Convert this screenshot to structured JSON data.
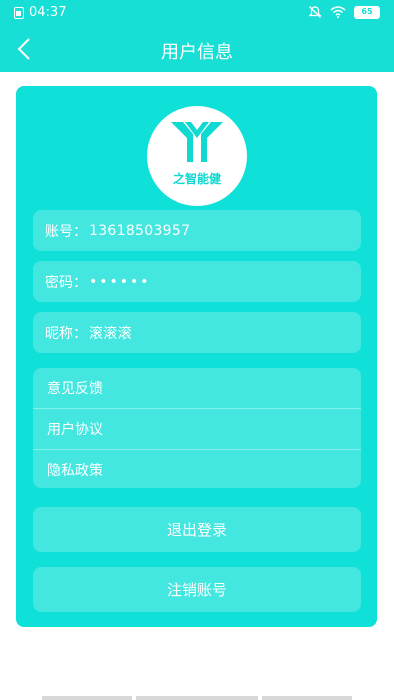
{
  "status_bar": {
    "time": "04:37",
    "battery": "65",
    "icons": [
      "sim-icon",
      "mute-icon",
      "wifi-icon",
      "battery-icon"
    ]
  },
  "nav": {
    "title": "用户信息",
    "back_icon": "chevron-left-icon"
  },
  "logo": {
    "text": "之智能健"
  },
  "account": {
    "label": "账号：",
    "value": "13618503957"
  },
  "password": {
    "label": "密码：",
    "value": "••••••"
  },
  "nickname": {
    "label": "昵称：",
    "value": "滚滚滚"
  },
  "menu": {
    "feedback": "意见反馈",
    "agreement": "用户协议",
    "privacy": "隐私政策"
  },
  "actions": {
    "logout": "退出登录",
    "delete_account": "注销账号"
  },
  "colors": {
    "header": "#17dfd6",
    "card": "#0fe0d8"
  }
}
